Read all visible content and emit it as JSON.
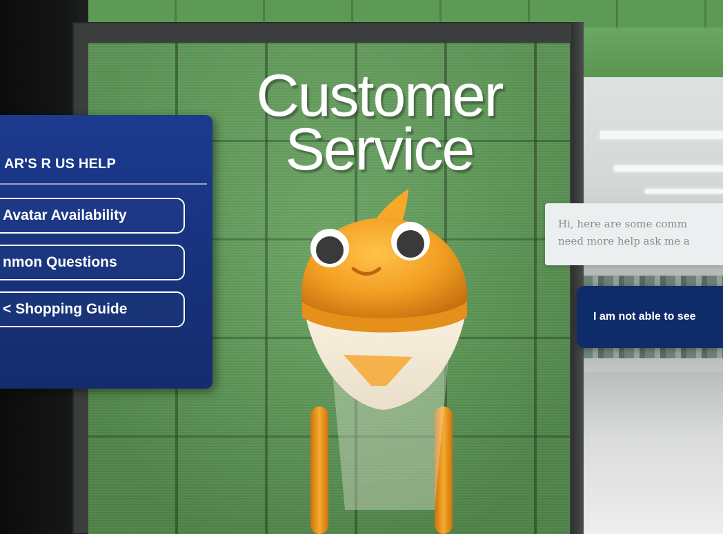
{
  "store_sign": {
    "line1": "Customer",
    "line2": "Service"
  },
  "help_panel": {
    "title": "AR'S R US HELP",
    "buttons": [
      {
        "label": "Avatar Availability"
      },
      {
        "label": "nmon Questions"
      },
      {
        "label": "Shopping Guide",
        "prefix_glyph": "<"
      }
    ],
    "colors": {
      "panel": "#17327d",
      "text": "#ffffff"
    }
  },
  "chat": {
    "bot_message_line1": "Hi, here are some comm",
    "bot_message_line2": "need more help ask me a",
    "user_message": "I am not able to see"
  },
  "mascot": {
    "icon": "orange-robot-fish-avatar",
    "color": "#f0a022"
  }
}
